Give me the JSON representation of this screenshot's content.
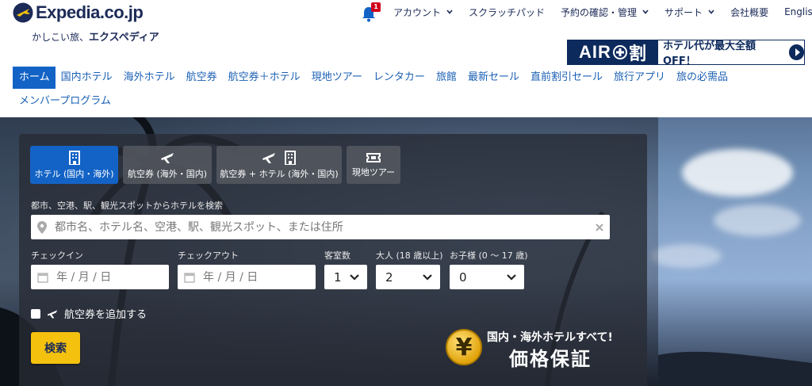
{
  "logo": {
    "name": "Expedia.co.jp",
    "tagline_prefix": "かしこい旅、",
    "tagline_brand": "エクスペディア"
  },
  "topnav": {
    "notification_count": "1",
    "items": [
      {
        "label": "アカウント",
        "dropdown": true
      },
      {
        "label": "スクラッチパッド",
        "dropdown": false
      },
      {
        "label": "予約の確認・管理",
        "dropdown": true
      },
      {
        "label": "サポート",
        "dropdown": true
      },
      {
        "label": "会社概要",
        "dropdown": false
      },
      {
        "label": "English",
        "dropdown": false
      }
    ]
  },
  "ad": {
    "left_a": "AIR",
    "left_b": "割",
    "right": "ホテル代が最大全額OFF！"
  },
  "mainnav": {
    "row1": [
      "ホーム",
      "国内ホテル",
      "海外ホテル",
      "航空券",
      "航空券＋ホテル",
      "現地ツアー",
      "レンタカー",
      "旅館",
      "最新セール",
      "直前割引セール",
      "旅行アプリ",
      "旅の必需品"
    ],
    "row2": [
      "メンバープログラム"
    ],
    "active_index": 0
  },
  "search": {
    "tabs": [
      {
        "label": "ホテル (国内・海外)",
        "icon": "building-icon"
      },
      {
        "label": "航空券 (海外・国内)",
        "icon": "plane-icon"
      },
      {
        "label": "航空券 + ホテル (海外・国内)",
        "icon": "plane-building-icon"
      },
      {
        "label": "現地ツアー",
        "icon": "ticket-icon"
      }
    ],
    "destination_label": "都市、空港、駅、観光スポットからホテルを検索",
    "destination_placeholder": "都市名、ホテル名、空港、駅、観光スポット、または住所",
    "checkin_label": "チェックイン",
    "checkin_placeholder": "年 / 月 / 日",
    "checkout_label": "チェックアウト",
    "checkout_placeholder": "年 / 月 / 日",
    "rooms_label": "客室数",
    "rooms_value": "1",
    "adults_label": "大人 (18 歳以上)",
    "adults_value": "2",
    "children_label": "お子様 (0 〜 17 歳)",
    "children_value": "0",
    "add_flight_label": "航空券を追加する",
    "search_button": "検索"
  },
  "guarantee": {
    "symbol": "¥",
    "line1": "国内・海外ホテルすべて!",
    "line2": "価格保証"
  },
  "colors": {
    "brand_navy": "#1b2a57",
    "link_blue": "#1a5fb4",
    "active_blue": "#1363c6",
    "search_yellow": "#f4c10f",
    "badge_red": "#d0021b"
  }
}
